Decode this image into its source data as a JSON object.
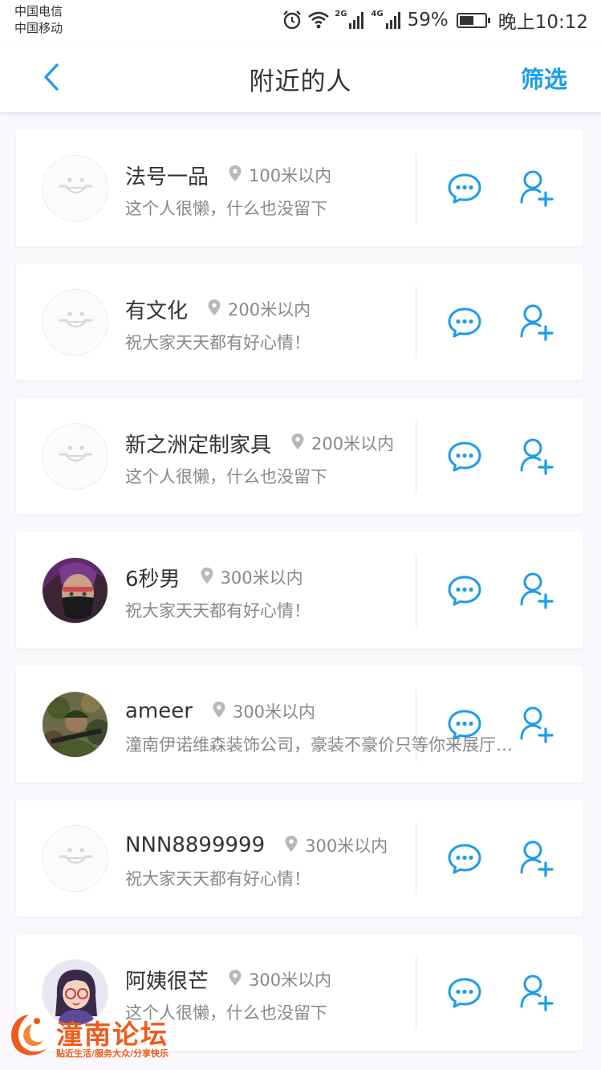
{
  "status_bar": {
    "carrier_1": "中国电信",
    "carrier_2": "中国移动",
    "net_1": "2G",
    "net_2": "4G",
    "battery": "59%",
    "battery_level": 0.59,
    "time": "晚上10:12"
  },
  "header": {
    "title": "附近的人",
    "filter_label": "筛选"
  },
  "colors": {
    "accent": "#1e9ce8",
    "watermark": "#f05a1a"
  },
  "people": [
    {
      "name": "法号一品",
      "distance": "100米以内",
      "signature": "这个人很懒，什么也没留下",
      "avatar": "default-face"
    },
    {
      "name": "有文化",
      "distance": "200米以内",
      "signature": "祝大家天天都有好心情！",
      "avatar": "default-face"
    },
    {
      "name": "新之洲定制家具",
      "distance": "200米以内",
      "signature": "这个人很懒，什么也没留下",
      "avatar": "default-face"
    },
    {
      "name": "6秒男",
      "distance": "300米以内",
      "signature": "祝大家天天都有好心情！",
      "avatar": "masked-character-photo"
    },
    {
      "name": "ameer",
      "distance": "300米以内",
      "signature": "潼南伊诺维森装饰公司，豪装不豪价只等你来展厅…",
      "avatar": "camouflage-soldier-photo"
    },
    {
      "name": "NNN8899999",
      "distance": "300米以内",
      "signature": "祝大家天天都有好心情！",
      "avatar": "default-face"
    },
    {
      "name": "阿姨很芒",
      "distance": "300米以内",
      "signature": "这个人很懒，什么也没留下",
      "avatar": "cartoon-girl-glasses"
    }
  ],
  "watermark": {
    "title": "潼南论坛",
    "subtitle": "贴近生活/服务大众/分享快乐"
  }
}
